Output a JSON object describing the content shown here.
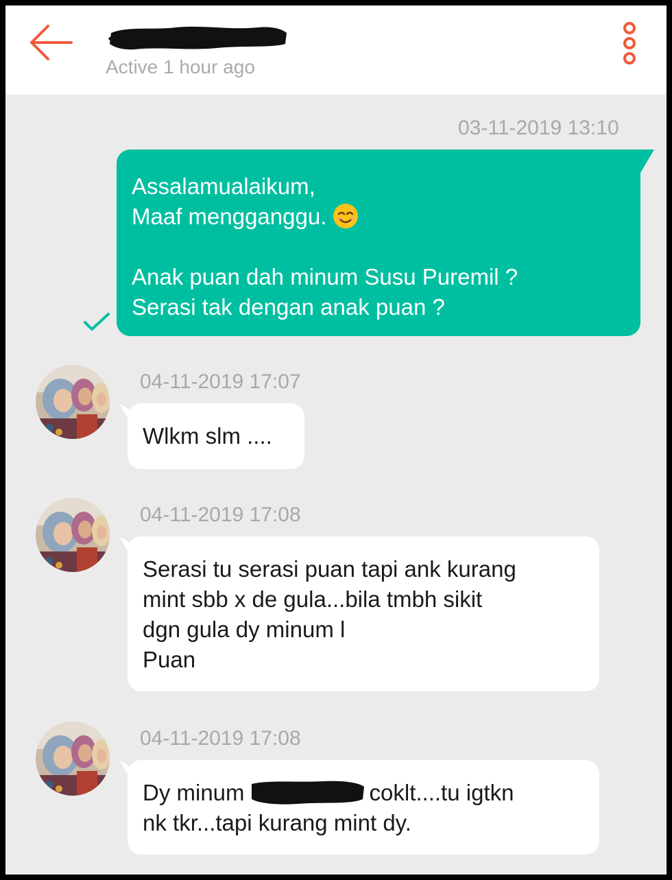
{
  "header": {
    "title_redacted": true,
    "subtitle": "Active 1 hour ago",
    "back_icon": "arrow-left-icon",
    "menu_icon": "more-vertical-icon",
    "accent_color": "#f05a3a"
  },
  "colors": {
    "background": "#ebebeb",
    "outgoing_bubble": "#00bfa0",
    "incoming_bubble": "#ffffff",
    "timestamp": "#a8a8a8"
  },
  "messages": [
    {
      "direction": "outgoing",
      "timestamp": "03-11-2019 13:10",
      "lines": [
        "Assalamualaikum,",
        "Maaf mengganggu.",
        "",
        "Anak puan dah minum Susu Puremil ?",
        "Serasi tak dengan anak puan ?"
      ],
      "status_icon": "check-icon"
    },
    {
      "direction": "incoming",
      "timestamp": "04-11-2019 17:07",
      "lines": [
        "Wlkm slm ...."
      ]
    },
    {
      "direction": "incoming",
      "timestamp": "04-11-2019 17:08",
      "lines": [
        "Serasi tu serasi puan tapi ank kurang",
        "mint sbb x de gula...bila tmbh sikit",
        "dgn gula dy minum l",
        "Puan"
      ]
    },
    {
      "direction": "incoming",
      "timestamp": "04-11-2019 17:08",
      "line1_before": "Dy minum",
      "line1_after": "coklt....tu igtkn",
      "line2": "nk tkr...tapi kurang mint dy."
    }
  ]
}
